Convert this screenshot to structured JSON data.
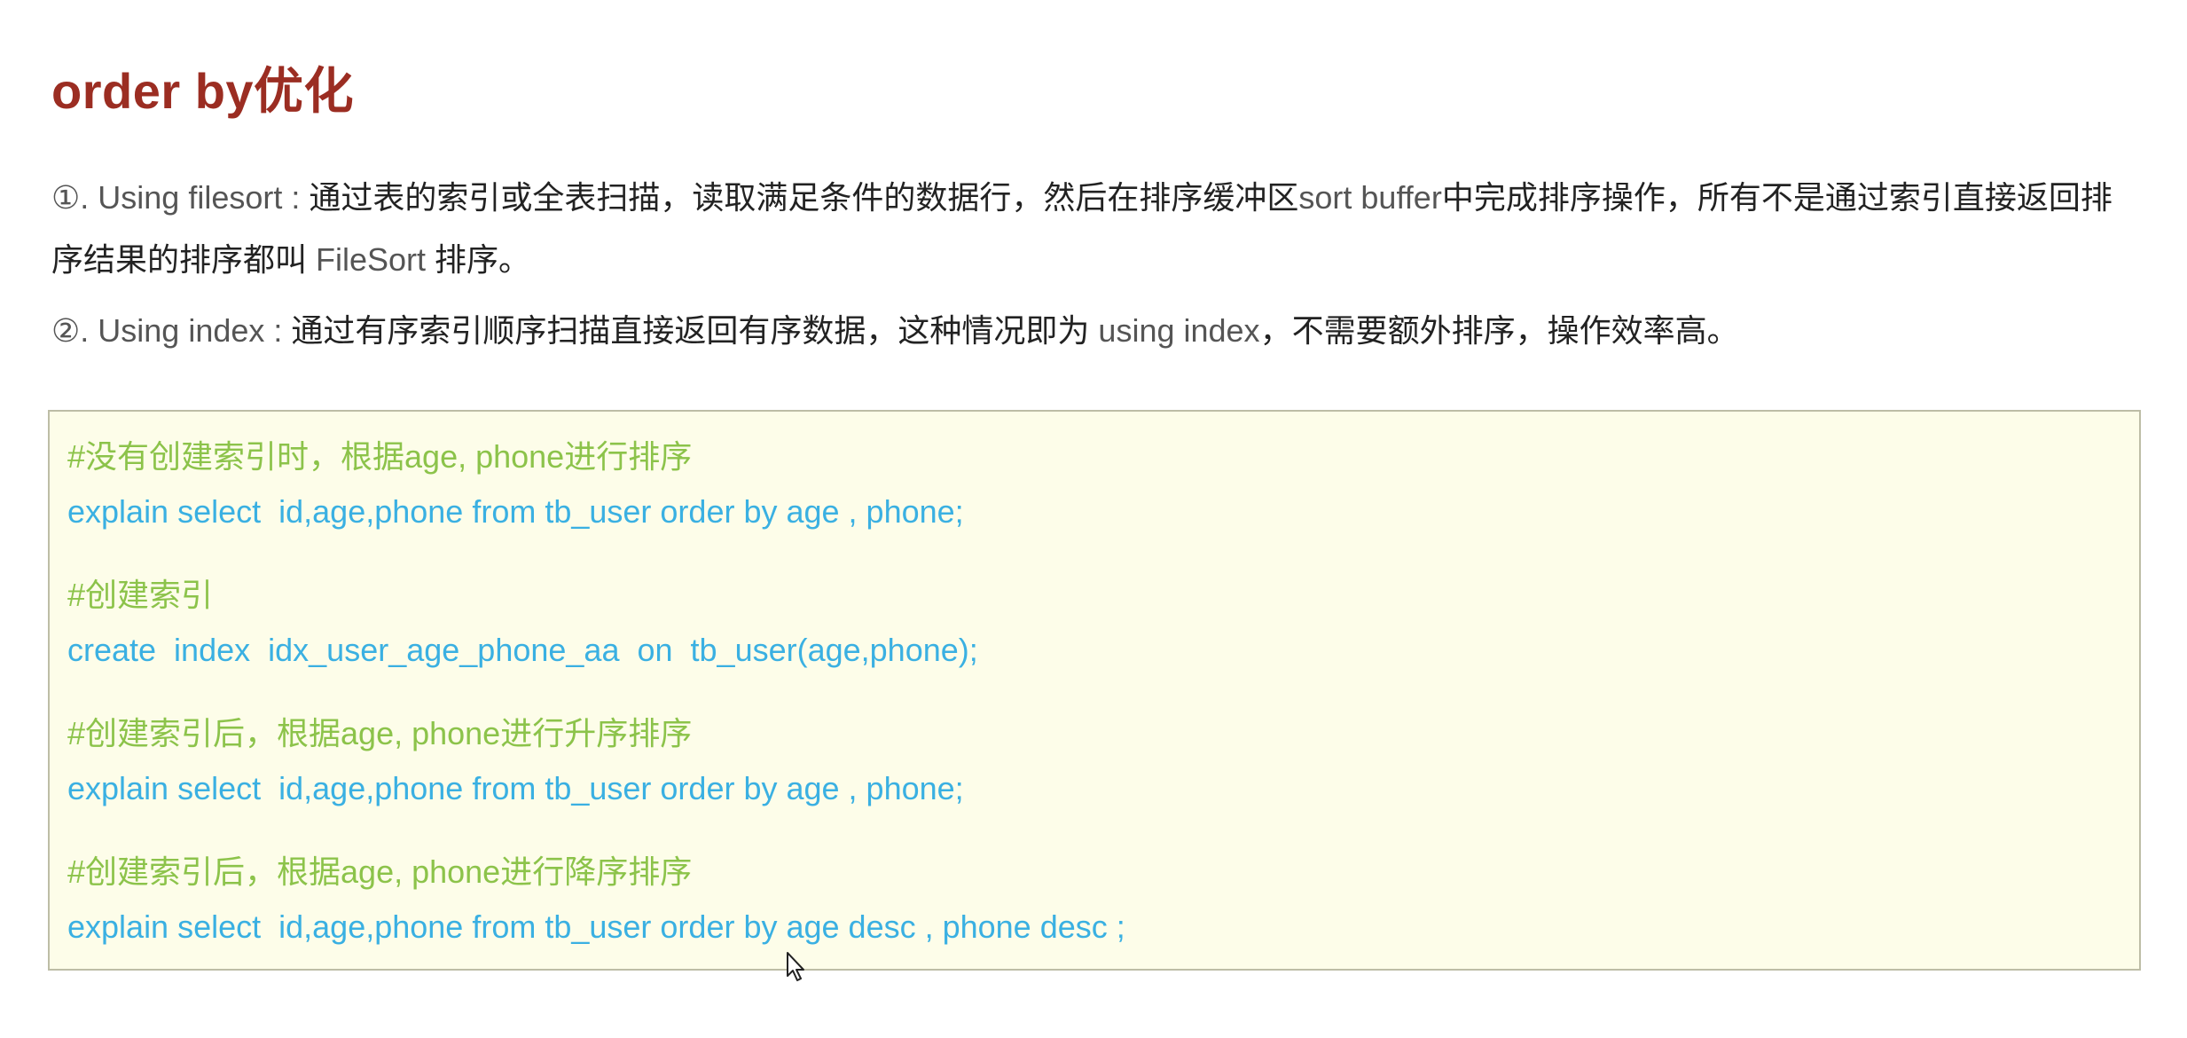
{
  "title": "order by优化",
  "points": [
    {
      "marker": "①.",
      "term": " Using filesort : ",
      "text_a": "通过表的索引或全表扫描，读取满足条件的数据行，然后在排序缓冲区",
      "text_b": "sort buffer",
      "text_c": "中完成排序操作，所有不是通过索引直接返回排序结果的排序都叫 ",
      "text_d": "FileSort",
      "text_e": " 排序。"
    },
    {
      "marker": "②.",
      "term": " Using index : ",
      "text_a": "通过有序索引顺序扫描直接返回有序数据，这种情况即为 ",
      "text_b": "using index",
      "text_c": "，不需要额外排序，操作效率高。"
    }
  ],
  "code_block": {
    "lines": [
      {
        "type": "comment",
        "text": "#没有创建索引时，根据age, phone进行排序"
      },
      {
        "type": "code",
        "text": "explain select  id,age,phone from tb_user order by age , phone;"
      },
      {
        "type": "comment",
        "text": "#创建索引"
      },
      {
        "type": "code",
        "text": "create  index  idx_user_age_phone_aa  on  tb_user(age,phone);"
      },
      {
        "type": "comment",
        "text": "#创建索引后，根据age, phone进行升序排序"
      },
      {
        "type": "code",
        "text": "explain select  id,age,phone from tb_user order by age , phone;"
      },
      {
        "type": "comment",
        "text": "#创建索引后，根据age, phone进行降序排序"
      },
      {
        "type": "code",
        "text": "explain select  id,age,phone from tb_user order by age desc , phone desc ;"
      }
    ]
  },
  "colors": {
    "title": "#9b2d22",
    "comment": "#8cc34a",
    "code": "#3ab0e2",
    "code_background": "#fdfde9"
  },
  "icons": {
    "cursor": "mouse-pointer-icon"
  }
}
